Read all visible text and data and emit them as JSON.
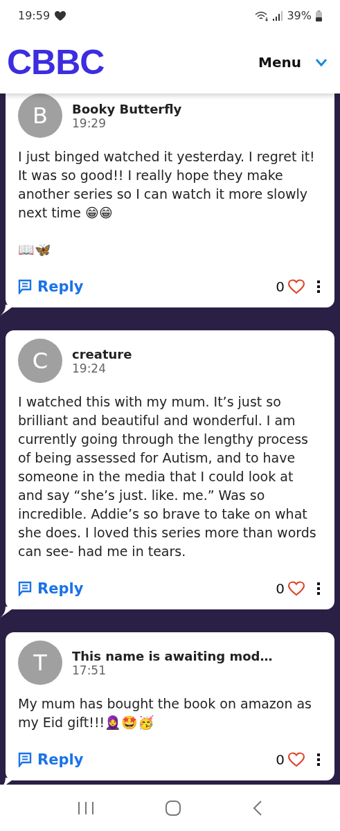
{
  "status_bar": {
    "time": "19:59",
    "battery": "39%"
  },
  "header": {
    "logo": "CBBC",
    "menu": "Menu"
  },
  "comments": [
    {
      "avatar": "B",
      "name": "Booky Butterfly",
      "time": "19:29",
      "paragraphs": [
        "I just binged watched it yesterday. I regret it! It was so good!! I really hope they make another series so I can watch it more slowly next time 😁😁",
        "📖🦋"
      ],
      "reply": "Reply",
      "likes": "0"
    },
    {
      "avatar": "C",
      "name": "creature",
      "time": "19:24",
      "paragraphs": [
        "I watched this with my mum. It’s just so brilliant and beautiful and wonderful. I am currently going through the lengthy process of being assessed for Autism, and to have someone in the media that I could look at and say “she’s just. like. me.” Was so incredible. Addie’s so brave to take on what she does. I loved this series more than words can see- had me in tears."
      ],
      "reply": "Reply",
      "likes": "0"
    },
    {
      "avatar": "T",
      "name": "This name is awaiting mod…",
      "time": "17:51",
      "paragraphs": [
        "My mum has bought the book on amazon as my Eid gift!!!🧕🤩🥳"
      ],
      "reply": "Reply",
      "likes": "0"
    }
  ]
}
